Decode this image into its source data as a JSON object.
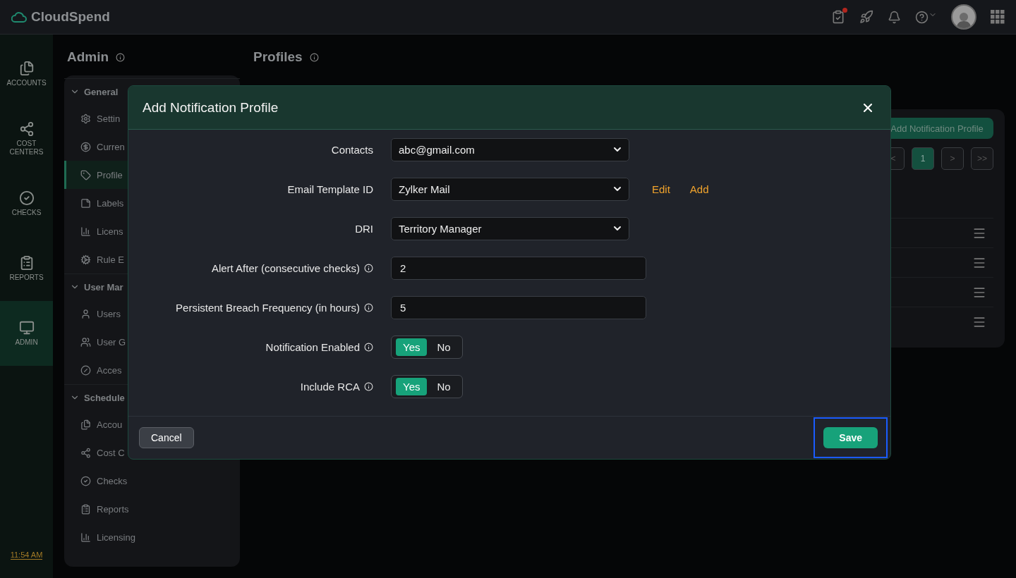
{
  "app": {
    "name": "CloudSpend",
    "time": "11:54 AM",
    "tasks_badge": true
  },
  "nav": [
    {
      "label": "ACCOUNTS",
      "selected": false
    },
    {
      "label": "COST CENTERS",
      "selected": false
    },
    {
      "label": "CHECKS",
      "selected": false
    },
    {
      "label": "REPORTS",
      "selected": false
    },
    {
      "label": "ADMIN",
      "selected": true
    }
  ],
  "admin_panel": {
    "title": "Admin",
    "sections": [
      {
        "title": "General",
        "expanded": true,
        "items": [
          {
            "label": "Settin",
            "selected": false
          },
          {
            "label": "Curren",
            "selected": false
          },
          {
            "label": "Profile",
            "selected": true
          },
          {
            "label": "Labels",
            "selected": false
          },
          {
            "label": "Licens",
            "selected": false
          },
          {
            "label": "Rule E",
            "selected": false
          }
        ]
      },
      {
        "title": "User Mar",
        "expanded": true,
        "items": [
          {
            "label": "Users",
            "selected": false
          },
          {
            "label": "User G",
            "selected": false
          },
          {
            "label": "Acces",
            "selected": false
          }
        ]
      },
      {
        "title": "Schedule",
        "expanded": true,
        "items": [
          {
            "label": "Accou",
            "selected": false
          },
          {
            "label": "Cost C",
            "selected": false
          },
          {
            "label": "Checks",
            "selected": false
          },
          {
            "label": "Reports",
            "selected": false
          },
          {
            "label": "Licensing",
            "selected": false
          }
        ]
      }
    ]
  },
  "page": {
    "title": "Profiles"
  },
  "background_card": {
    "button": "Add Notification Profile",
    "pagination": [
      {
        "label": "<",
        "selected": false
      },
      {
        "label": "1",
        "selected": true
      },
      {
        "label": ">",
        "selected": false
      },
      {
        "label": ">>",
        "selected": false
      }
    ]
  },
  "dialog": {
    "title": "Add Notification Profile",
    "fields": [
      {
        "kind": "select",
        "label": "Contacts",
        "info": false,
        "value": "abc@gmail.com"
      },
      {
        "kind": "select",
        "label": "Email Template ID",
        "info": false,
        "value": "Zylker Mail",
        "links": [
          "Edit",
          "Add"
        ]
      },
      {
        "kind": "select",
        "label": "DRI",
        "info": false,
        "value": "Territory Manager"
      },
      {
        "kind": "input",
        "label": "Alert After (consecutive checks)",
        "info": true,
        "value": "2"
      },
      {
        "kind": "input",
        "label": "Persistent Breach Frequency (in hours)",
        "info": true,
        "value": "5"
      },
      {
        "kind": "toggle",
        "label": "Notification Enabled",
        "info": true,
        "options": [
          {
            "label": "Yes",
            "selected": true
          },
          {
            "label": "No",
            "selected": false
          }
        ]
      },
      {
        "kind": "toggle",
        "label": "Include RCA",
        "info": true,
        "options": [
          {
            "label": "Yes",
            "selected": true
          },
          {
            "label": "No",
            "selected": false
          }
        ]
      }
    ],
    "cancel": "Cancel",
    "save": {
      "label": "Save",
      "highlighted": true
    }
  }
}
